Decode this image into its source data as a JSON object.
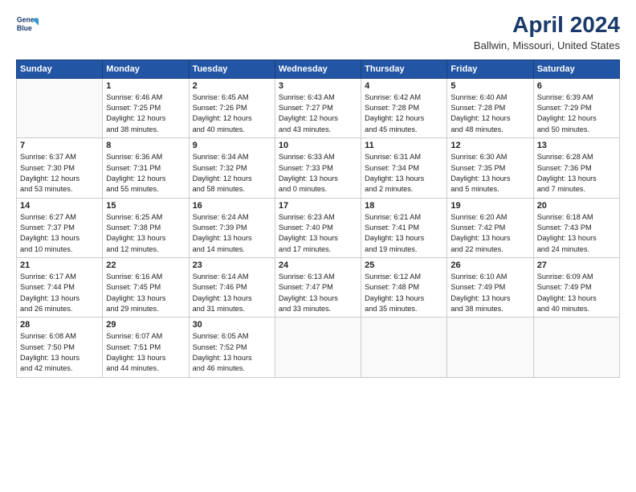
{
  "header": {
    "logo_line1": "General",
    "logo_line2": "Blue",
    "title": "April 2024",
    "subtitle": "Ballwin, Missouri, United States"
  },
  "weekdays": [
    "Sunday",
    "Monday",
    "Tuesday",
    "Wednesday",
    "Thursday",
    "Friday",
    "Saturday"
  ],
  "weeks": [
    [
      {
        "day": "",
        "info": ""
      },
      {
        "day": "1",
        "info": "Sunrise: 6:46 AM\nSunset: 7:25 PM\nDaylight: 12 hours\nand 38 minutes."
      },
      {
        "day": "2",
        "info": "Sunrise: 6:45 AM\nSunset: 7:26 PM\nDaylight: 12 hours\nand 40 minutes."
      },
      {
        "day": "3",
        "info": "Sunrise: 6:43 AM\nSunset: 7:27 PM\nDaylight: 12 hours\nand 43 minutes."
      },
      {
        "day": "4",
        "info": "Sunrise: 6:42 AM\nSunset: 7:28 PM\nDaylight: 12 hours\nand 45 minutes."
      },
      {
        "day": "5",
        "info": "Sunrise: 6:40 AM\nSunset: 7:28 PM\nDaylight: 12 hours\nand 48 minutes."
      },
      {
        "day": "6",
        "info": "Sunrise: 6:39 AM\nSunset: 7:29 PM\nDaylight: 12 hours\nand 50 minutes."
      }
    ],
    [
      {
        "day": "7",
        "info": "Sunrise: 6:37 AM\nSunset: 7:30 PM\nDaylight: 12 hours\nand 53 minutes."
      },
      {
        "day": "8",
        "info": "Sunrise: 6:36 AM\nSunset: 7:31 PM\nDaylight: 12 hours\nand 55 minutes."
      },
      {
        "day": "9",
        "info": "Sunrise: 6:34 AM\nSunset: 7:32 PM\nDaylight: 12 hours\nand 58 minutes."
      },
      {
        "day": "10",
        "info": "Sunrise: 6:33 AM\nSunset: 7:33 PM\nDaylight: 13 hours\nand 0 minutes."
      },
      {
        "day": "11",
        "info": "Sunrise: 6:31 AM\nSunset: 7:34 PM\nDaylight: 13 hours\nand 2 minutes."
      },
      {
        "day": "12",
        "info": "Sunrise: 6:30 AM\nSunset: 7:35 PM\nDaylight: 13 hours\nand 5 minutes."
      },
      {
        "day": "13",
        "info": "Sunrise: 6:28 AM\nSunset: 7:36 PM\nDaylight: 13 hours\nand 7 minutes."
      }
    ],
    [
      {
        "day": "14",
        "info": "Sunrise: 6:27 AM\nSunset: 7:37 PM\nDaylight: 13 hours\nand 10 minutes."
      },
      {
        "day": "15",
        "info": "Sunrise: 6:25 AM\nSunset: 7:38 PM\nDaylight: 13 hours\nand 12 minutes."
      },
      {
        "day": "16",
        "info": "Sunrise: 6:24 AM\nSunset: 7:39 PM\nDaylight: 13 hours\nand 14 minutes."
      },
      {
        "day": "17",
        "info": "Sunrise: 6:23 AM\nSunset: 7:40 PM\nDaylight: 13 hours\nand 17 minutes."
      },
      {
        "day": "18",
        "info": "Sunrise: 6:21 AM\nSunset: 7:41 PM\nDaylight: 13 hours\nand 19 minutes."
      },
      {
        "day": "19",
        "info": "Sunrise: 6:20 AM\nSunset: 7:42 PM\nDaylight: 13 hours\nand 22 minutes."
      },
      {
        "day": "20",
        "info": "Sunrise: 6:18 AM\nSunset: 7:43 PM\nDaylight: 13 hours\nand 24 minutes."
      }
    ],
    [
      {
        "day": "21",
        "info": "Sunrise: 6:17 AM\nSunset: 7:44 PM\nDaylight: 13 hours\nand 26 minutes."
      },
      {
        "day": "22",
        "info": "Sunrise: 6:16 AM\nSunset: 7:45 PM\nDaylight: 13 hours\nand 29 minutes."
      },
      {
        "day": "23",
        "info": "Sunrise: 6:14 AM\nSunset: 7:46 PM\nDaylight: 13 hours\nand 31 minutes."
      },
      {
        "day": "24",
        "info": "Sunrise: 6:13 AM\nSunset: 7:47 PM\nDaylight: 13 hours\nand 33 minutes."
      },
      {
        "day": "25",
        "info": "Sunrise: 6:12 AM\nSunset: 7:48 PM\nDaylight: 13 hours\nand 35 minutes."
      },
      {
        "day": "26",
        "info": "Sunrise: 6:10 AM\nSunset: 7:49 PM\nDaylight: 13 hours\nand 38 minutes."
      },
      {
        "day": "27",
        "info": "Sunrise: 6:09 AM\nSunset: 7:49 PM\nDaylight: 13 hours\nand 40 minutes."
      }
    ],
    [
      {
        "day": "28",
        "info": "Sunrise: 6:08 AM\nSunset: 7:50 PM\nDaylight: 13 hours\nand 42 minutes."
      },
      {
        "day": "29",
        "info": "Sunrise: 6:07 AM\nSunset: 7:51 PM\nDaylight: 13 hours\nand 44 minutes."
      },
      {
        "day": "30",
        "info": "Sunrise: 6:05 AM\nSunset: 7:52 PM\nDaylight: 13 hours\nand 46 minutes."
      },
      {
        "day": "",
        "info": ""
      },
      {
        "day": "",
        "info": ""
      },
      {
        "day": "",
        "info": ""
      },
      {
        "day": "",
        "info": ""
      }
    ]
  ]
}
